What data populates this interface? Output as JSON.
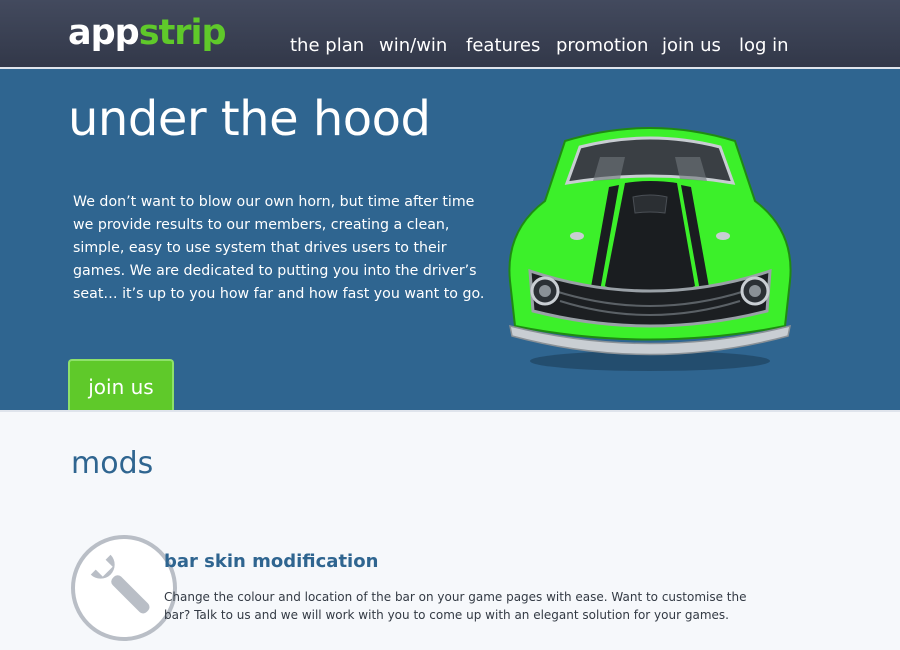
{
  "brand": {
    "logo_part1": "app",
    "logo_part2": "strip"
  },
  "nav": {
    "items": [
      {
        "label": "the plan"
      },
      {
        "label": "win/win"
      },
      {
        "label": "features"
      },
      {
        "label": "promotion"
      },
      {
        "label": "join us"
      },
      {
        "label": "log in"
      }
    ]
  },
  "hero": {
    "title": "under the hood",
    "body": "We don’t want to blow our own horn, but time after time we provide results to our members, creating a clean, simple, easy to use system that drives users to their games. We are dedicated to putting you into the driver’s seat… it’s up to you how far and how fast you want to go.",
    "cta_label": "join us",
    "car_color": "#3cf02a"
  },
  "colors": {
    "nav_bg": "#3a4154",
    "hero_bg": "#2f6590",
    "brand_green": "#5fc92a",
    "heading_blue": "#2f6590"
  },
  "mods": {
    "title": "mods",
    "items": [
      {
        "title": "bar skin modification",
        "description": "Change the colour and location of the bar on your game pages with ease. Want to customise the bar? Talk to us and we will work with you to come up with an elegant solution for your games.",
        "icon": "wrench-icon"
      }
    ]
  }
}
